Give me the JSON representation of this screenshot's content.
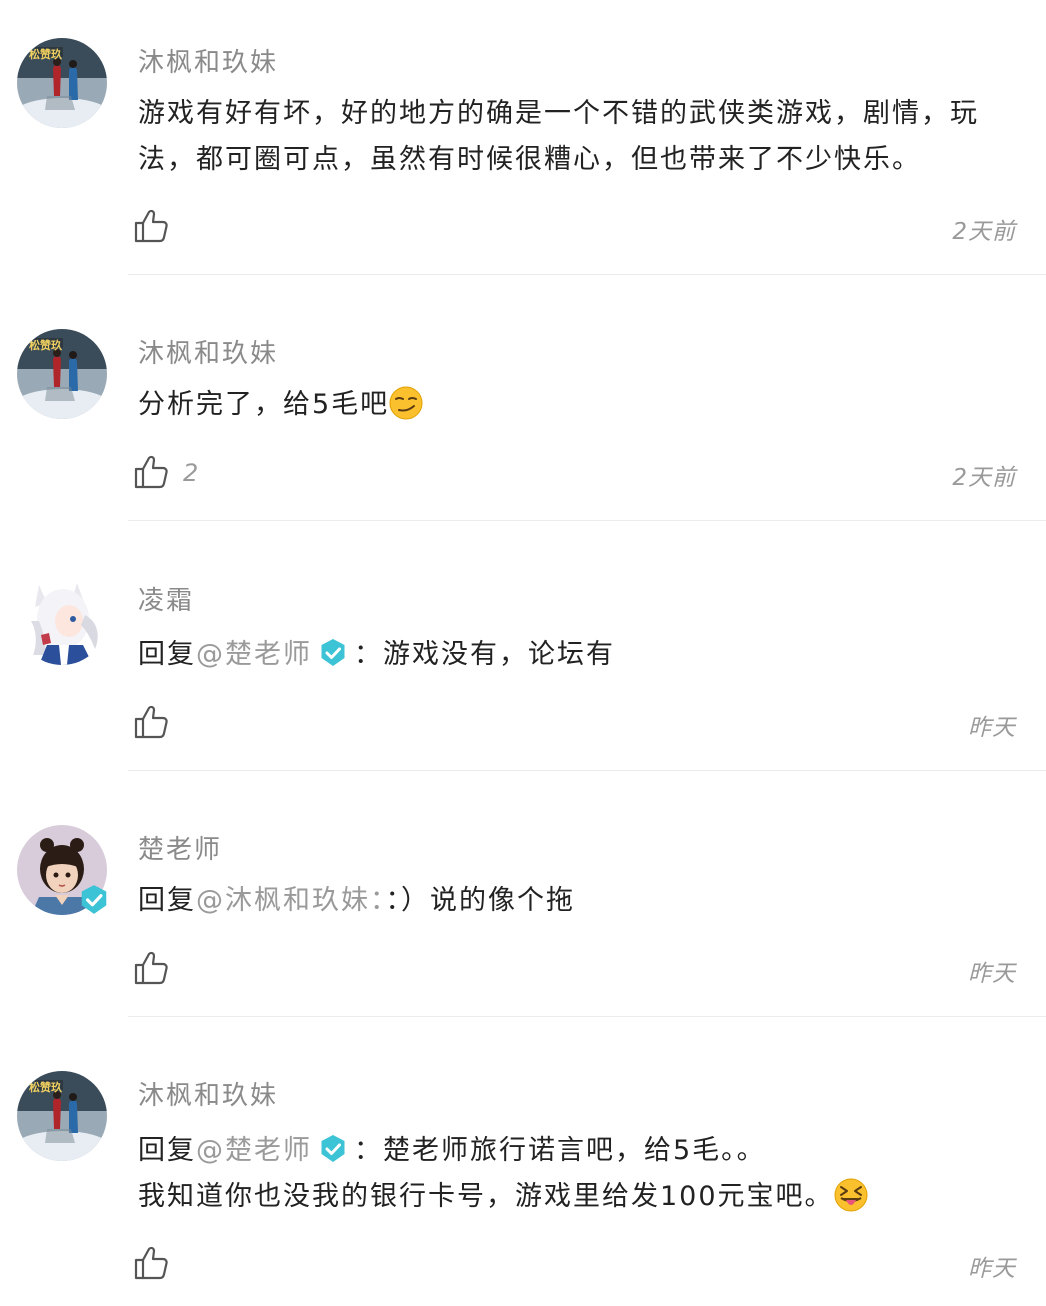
{
  "comments": [
    {
      "name": "沐枫和玖妹",
      "text": "游戏有好有坏，好的地方的确是一个不错的武侠类游戏，剧情，玩法，都可圈可点，虽然有时候很糟心，但也带来了不少快乐。",
      "like_count": "",
      "time": "2天前",
      "avatar_label": "松赞玖"
    },
    {
      "name": "沐枫和玖妹",
      "text": "分析完了，给5毛吧",
      "emoji": "smirk-emoji",
      "like_count": "2",
      "time": "2天前",
      "avatar_label": "松赞玖"
    },
    {
      "name": "凌霜",
      "reply_prefix": "回复",
      "mention": "@楚老师",
      "after_mention": "：游戏没有，论坛有",
      "like_count": "",
      "time": "昨天"
    },
    {
      "name": "楚老师",
      "reply_prefix": "回复",
      "mention": "@沐枫和玖妹：",
      "after_mention": "：）说的像个拖",
      "like_count": "",
      "time": "昨天"
    },
    {
      "name": "沐枫和玖妹",
      "reply_prefix": "回复",
      "mention": "@楚老师",
      "after_mention": "：楚老师旅行诺言吧，给5毛。。",
      "line2": "我知道你也没我的银行卡号，游戏里给发100元宝吧。",
      "emoji": "tongue-out-emoji",
      "like_count": "",
      "time": "昨天",
      "avatar_label": "松赞玖"
    }
  ],
  "colors": {
    "name": "#8a8a8a",
    "text": "#222222",
    "mention": "#9a9a9a",
    "divider": "#ececec",
    "verified": "#3cc3d6"
  }
}
